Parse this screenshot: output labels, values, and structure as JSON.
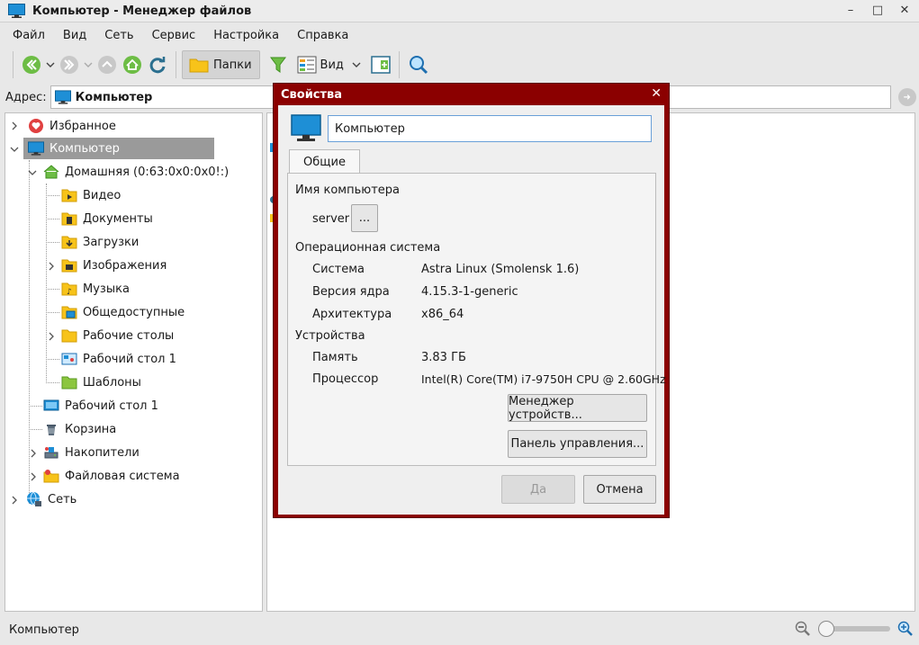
{
  "window": {
    "title": "Компьютер - Менеджер файлов"
  },
  "menu": [
    "Файл",
    "Вид",
    "Сеть",
    "Сервис",
    "Настройка",
    "Справка"
  ],
  "toolbar": {
    "folders_label": "Папки",
    "view_label": "Вид"
  },
  "address": {
    "label": "Адрес:",
    "value": "Компьютер"
  },
  "tree": {
    "favorites": "Избранное",
    "computer": "Компьютер",
    "home": "Домашняя (0:63:0x0:0x0!:)",
    "home_children": [
      "Видео",
      "Документы",
      "Загрузки",
      "Изображения",
      "Музыка",
      "Общедоступные",
      "Рабочие столы",
      "Рабочий стол 1",
      "Шаблоны"
    ],
    "desktop": "Рабочий стол 1",
    "trash": "Корзина",
    "drives": "Накопители",
    "filesystem": "Файловая система",
    "network": "Сеть"
  },
  "status": {
    "text": "Компьютер",
    "zoom_level": 0.0
  },
  "dialog": {
    "title": "Свойства",
    "name_value": "Компьютер",
    "tab_general": "Общие",
    "computer_name_header": "Имя компьютера",
    "hostname": "server",
    "hostname_button": "...",
    "os_header": "Операционная система",
    "system_label": "Система",
    "system_value": "Astra Linux (Smolensk 1.6)",
    "kernel_label": "Версия ядра",
    "kernel_value": "4.15.3-1-generic",
    "arch_label": "Архитектура",
    "arch_value": "x86_64",
    "devices_header": "Устройства",
    "memory_label": "Память",
    "memory_value": "3.83 ГБ",
    "cpu_label": "Процессор",
    "cpu_value": "Intel(R) Core(TM) i7-9750H CPU @ 2.60GHz",
    "device_manager_button": "Менеджер устройств...",
    "control_panel_button": "Панель управления...",
    "ok_button": "Да",
    "cancel_button": "Отмена"
  },
  "colors": {
    "dialog_frame": "#8b0000",
    "selection": "#9a9a9a",
    "accent_blue": "#1e8fd6",
    "nav_green": "#6dbd45"
  }
}
